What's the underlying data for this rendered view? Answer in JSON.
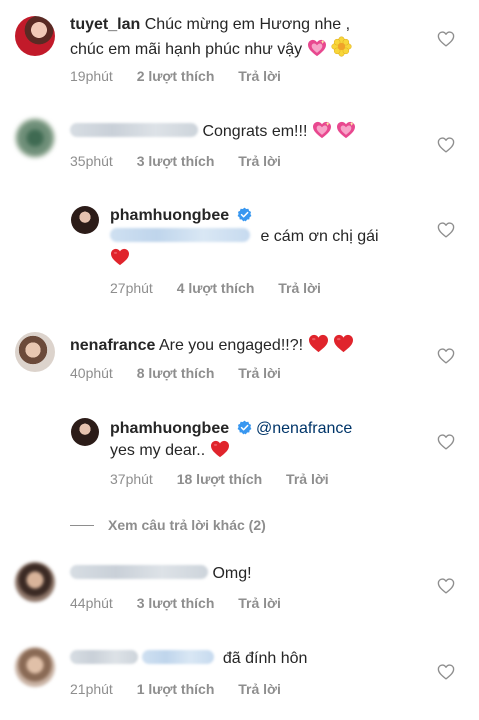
{
  "comments": [
    {
      "username": "tuyet_lan",
      "text_line1": "Chúc mừng em Hương nhe ,",
      "text_line2": "chúc em mãi hạnh phúc như vậy",
      "time": "19phút",
      "likes": "2 lượt thích",
      "reply": "Trả lời"
    },
    {
      "text": "Congrats em!!!",
      "time": "35phút",
      "likes": "3 lượt thích",
      "reply": "Trả lời"
    },
    {
      "username": "phamhuongbee",
      "text_line1": "e cám ơn chị gái",
      "time": "27phút",
      "likes": "4 lượt thích",
      "reply": "Trả lời"
    },
    {
      "username": "nenafrance",
      "text": "Are you engaged!!?!",
      "time": "40phút",
      "likes": "8 lượt thích",
      "reply": "Trả lời"
    },
    {
      "username": "phamhuongbee",
      "mention": "@nenafrance",
      "text_line2": "yes my dear..",
      "time": "37phút",
      "likes": "18 lượt thích",
      "reply": "Trả lời"
    },
    {
      "text": "Omg!",
      "time": "44phút",
      "likes": "3 lượt thích",
      "reply": "Trả lời"
    },
    {
      "text": "đã đính hôn",
      "time": "21phút",
      "likes": "1 lượt thích",
      "reply": "Trả lời"
    }
  ],
  "more_replies": "Xem câu trả lời khác (2)",
  "icons": {
    "like": "heart-outline-icon",
    "verified": "verified-badge-icon",
    "red_heart": "red-heart-emoji",
    "pink_hearts": "sparkling-heart-emoji",
    "blossom": "blossom-emoji"
  },
  "colors": {
    "text": "#262626",
    "meta": "#8e8e8e",
    "verified": "#3897f0",
    "mention": "#003569",
    "red_heart": "#e0242c",
    "pink_heart": "#e8488f"
  }
}
